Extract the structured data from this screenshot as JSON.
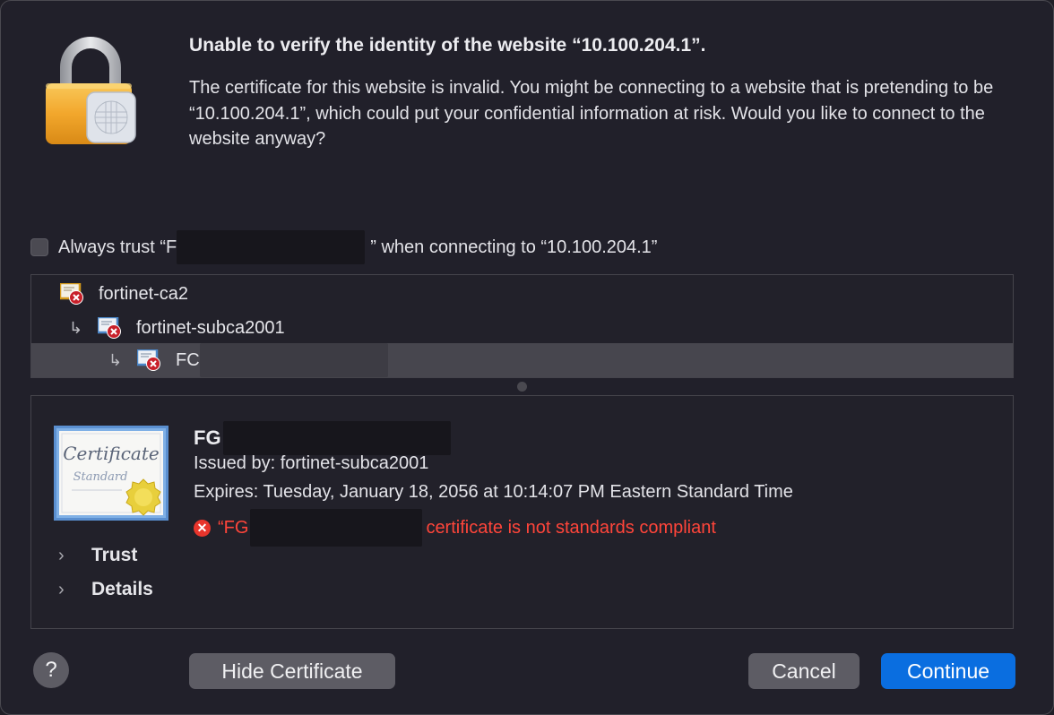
{
  "dialog": {
    "title": "Unable to verify the identity of the website “10.100.204.1”.",
    "message": "The certificate for this website is invalid. You might be connecting to a website that is pretending to be “10.100.204.1”, which could put your confidential information at risk. Would you like to connect to the website anyway?"
  },
  "trust": {
    "checked": false,
    "prefix": "Always trust “F",
    "suffix": "” when connecting to “10.100.204.1”"
  },
  "chain": {
    "items": [
      {
        "label": "fortinet-ca2",
        "level": 0,
        "selected": false
      },
      {
        "label": "fortinet-subca2001",
        "level": 1,
        "selected": false
      },
      {
        "label": "FC",
        "level": 2,
        "selected": true
      }
    ],
    "child_arrow": "↳"
  },
  "certificate": {
    "art_title": "Certificate",
    "art_subtitle": "Standard",
    "name": "FG",
    "issued_by": "Issued by: fortinet-subca2001",
    "expires": "Expires: Tuesday, January 18, 2056 at 10:14:07 PM Eastern Standard Time",
    "error_prefix": "“FG",
    "error_suffix": "certificate is not standards compliant",
    "error_color": "#ff453a"
  },
  "sections": {
    "trust_label": "Trust",
    "details_label": "Details",
    "chevron": "›"
  },
  "buttons": {
    "help": "?",
    "hide_certificate": "Hide Certificate",
    "cancel": "Cancel",
    "continue": "Continue"
  },
  "colors": {
    "accent": "#0a6ee0",
    "background": "#21202a"
  }
}
